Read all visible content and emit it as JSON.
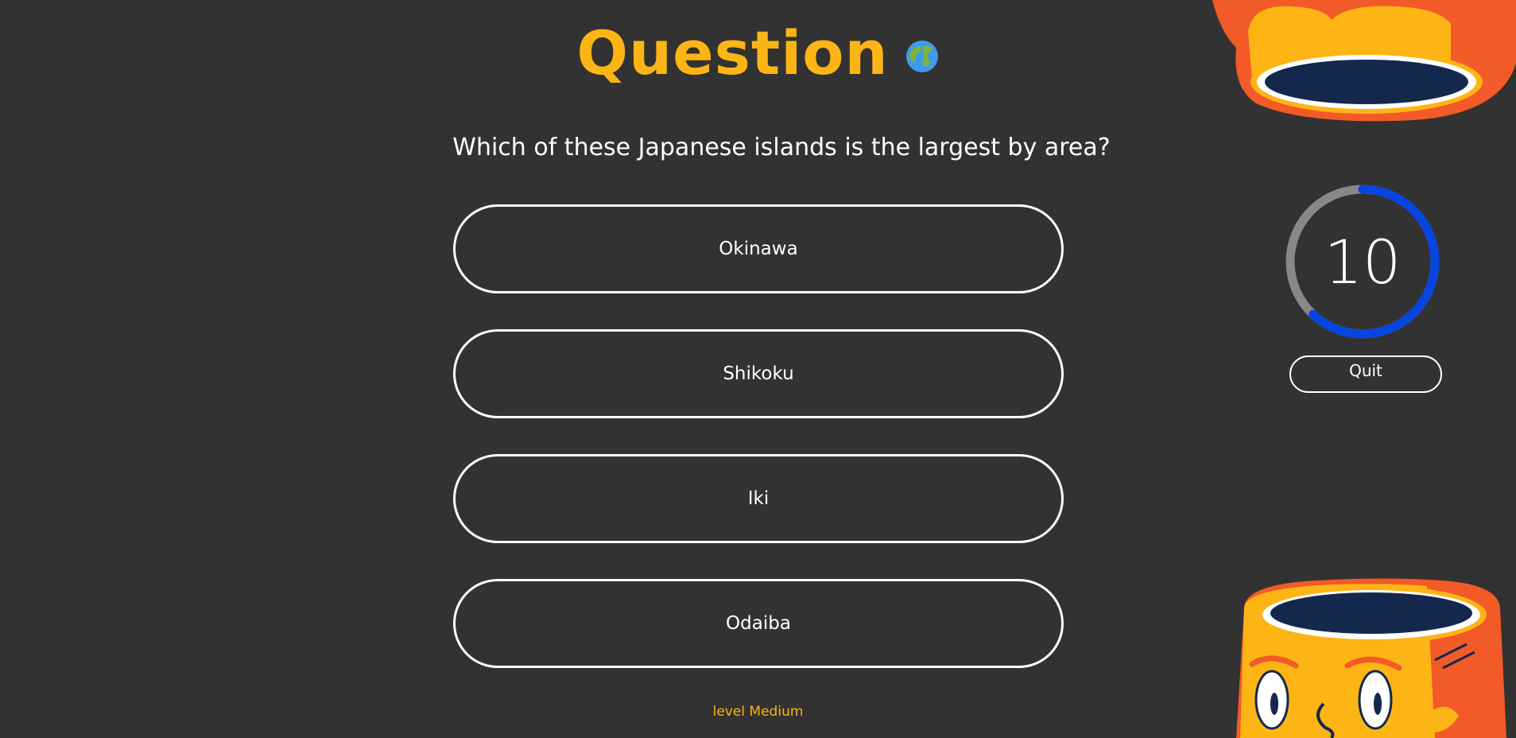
{
  "header": {
    "title": "Question",
    "title_icon": "globe-icon",
    "title_color": "#FDB515"
  },
  "question": {
    "text": "Which of these Japanese islands is the largest by area?"
  },
  "answers": [
    {
      "label": "Okinawa"
    },
    {
      "label": "Shikoku"
    },
    {
      "label": "Iki"
    },
    {
      "label": "Odaiba"
    }
  ],
  "timer": {
    "value": "10",
    "progress_fraction": 0.62,
    "ring_color": "#0645E0",
    "track_color": "#888888"
  },
  "controls": {
    "quit_label": "Quit"
  },
  "footer": {
    "level_text": "level Medium"
  },
  "colors": {
    "background": "#323232",
    "accent": "#FDB515",
    "mascot_orange": "#F25A27",
    "mascot_navy": "#14284E"
  }
}
